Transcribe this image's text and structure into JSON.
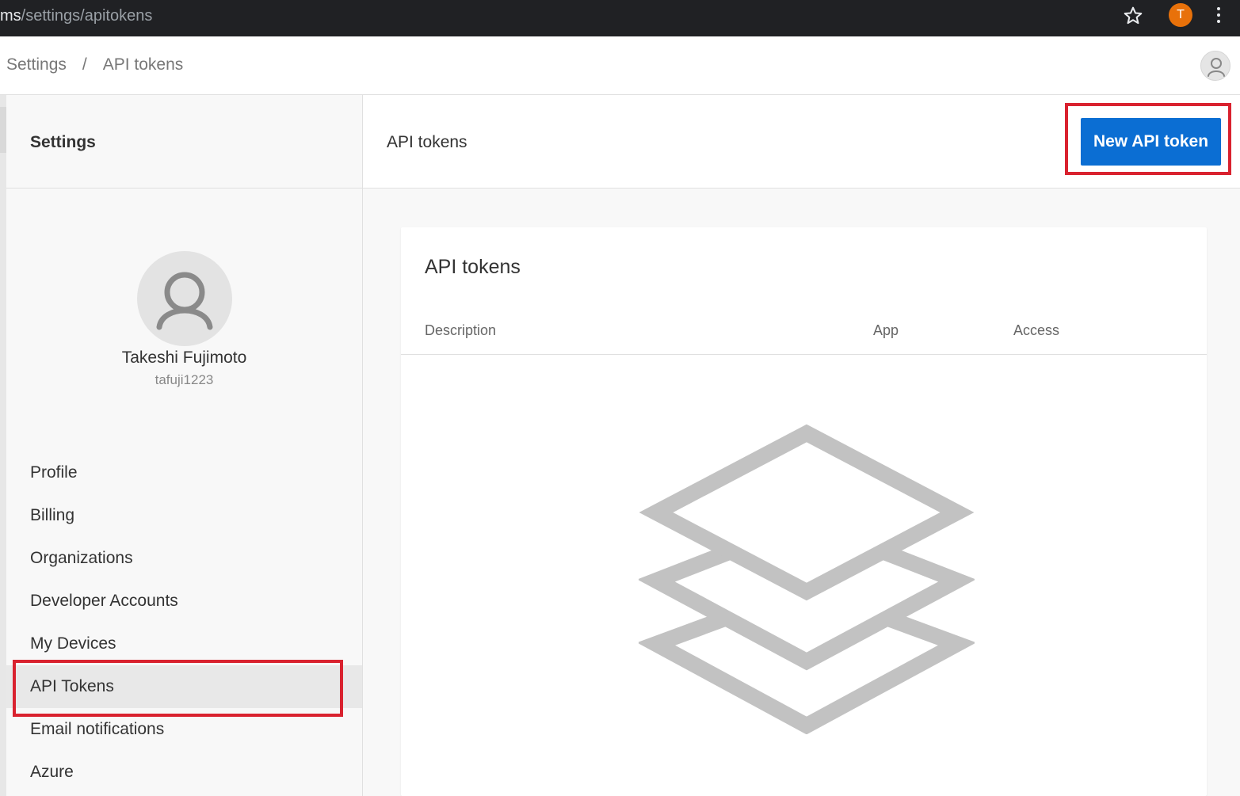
{
  "browser": {
    "url_host": "ms",
    "url_path": "/settings/apitokens",
    "profile_initial": "T"
  },
  "header": {
    "breadcrumb": [
      "Settings",
      "/",
      "API tokens"
    ]
  },
  "sidebar": {
    "title": "Settings",
    "user": {
      "name": "Takeshi Fujimoto",
      "handle": "tafuji1223"
    },
    "items": [
      {
        "label": "Profile"
      },
      {
        "label": "Billing"
      },
      {
        "label": "Organizations"
      },
      {
        "label": "Developer Accounts"
      },
      {
        "label": "My Devices"
      },
      {
        "label": "API Tokens",
        "active": true
      },
      {
        "label": "Email notifications"
      },
      {
        "label": "Azure"
      }
    ]
  },
  "main": {
    "title": "API tokens",
    "new_button_label": "New API token",
    "card": {
      "title": "API tokens",
      "columns": [
        "Description",
        "App",
        "Access"
      ]
    }
  },
  "colors": {
    "accent": "#0b6ed3",
    "highlight": "#d9222f",
    "profile_badge": "#e8710a"
  }
}
